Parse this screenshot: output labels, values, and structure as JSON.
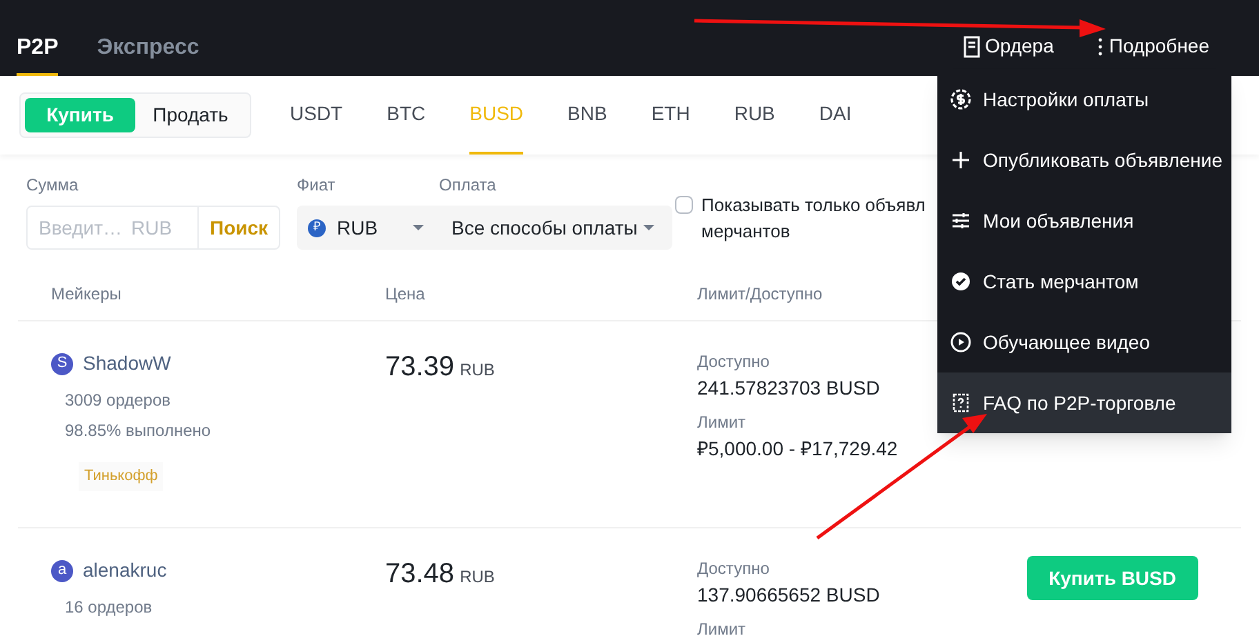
{
  "top_tabs": [
    {
      "label": "P2P",
      "selected": true
    },
    {
      "label": "Экспресс",
      "selected": false
    }
  ],
  "header_links": [
    {
      "kind": "orders",
      "label": "Ордера"
    },
    {
      "kind": "more",
      "label": "Подробнее"
    }
  ],
  "side_toggle": [
    {
      "label": "Купить",
      "selected": true
    },
    {
      "label": "Продать",
      "selected": false
    }
  ],
  "coins": [
    {
      "label": "USDT",
      "selected": false
    },
    {
      "label": "BTC",
      "selected": false
    },
    {
      "label": "BUSD",
      "selected": true
    },
    {
      "label": "BNB",
      "selected": false
    },
    {
      "label": "ETH",
      "selected": false
    },
    {
      "label": "RUB",
      "selected": false
    },
    {
      "label": "DAI",
      "selected": false
    }
  ],
  "filters": {
    "amount_label": "Сумма",
    "amount_placeholder": "Введит…",
    "amount_currency": "RUB",
    "search_button": "Поиск",
    "fiat_label": "Фиат",
    "fiat_value": "RUB",
    "fiat_icon": "₽",
    "payment_label": "Оплата",
    "payment_value": "Все способы оплаты",
    "merchant_checkbox": {
      "checked": false,
      "label_lines": [
        "Показывать только объявл",
        "мерчантов"
      ]
    }
  },
  "table": {
    "columns": [
      "Мейкеры",
      "Цена",
      "Лимит/Доступно"
    ],
    "rows": [
      {
        "avatar": "S",
        "name": "ShadowW",
        "orders": "3009 ордеров",
        "completion": "98.85% выполнено",
        "payment_tag": "Тинькофф",
        "price": "73.39",
        "currency": "RUB",
        "available_label": "Доступно",
        "available": "241.57823703 BUSD",
        "limit_label": "Лимит",
        "limit": "₽5,000.00 - ₽17,729.42"
      },
      {
        "avatar": "a",
        "name": "alenakruc",
        "orders": "16 ордеров",
        "price": "73.48",
        "currency": "RUB",
        "available_label": "Доступно",
        "available": "137.90665652 BUSD",
        "limit_label": "Лимит",
        "action": "Купить BUSD"
      }
    ]
  },
  "menu": {
    "items": [
      {
        "kind": "payment",
        "label": "Настройки оплаты",
        "selected": false
      },
      {
        "kind": "publish",
        "label": "Опубликовать объявление",
        "selected": false
      },
      {
        "kind": "ads",
        "label": "Мои объявления",
        "selected": false
      },
      {
        "kind": "merchant",
        "label": "Стать мерчантом",
        "selected": false
      },
      {
        "kind": "video",
        "label": "Обучающее видео",
        "selected": false
      },
      {
        "kind": "faq",
        "label": "FAQ по P2P-торговле",
        "selected": true
      }
    ]
  }
}
